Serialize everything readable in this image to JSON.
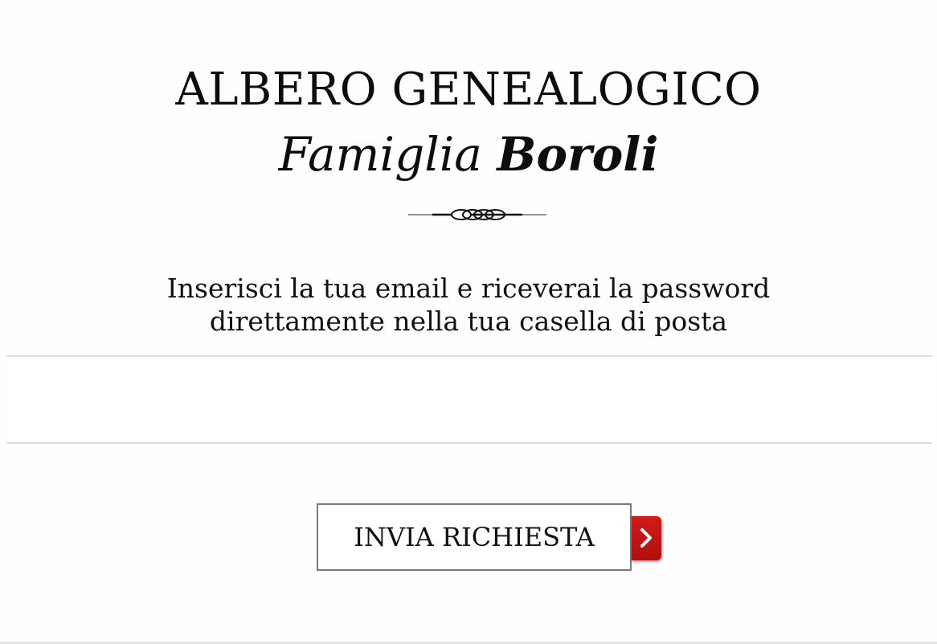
{
  "header": {
    "title": "ALBERO GENEALOGICO",
    "subtitle_prefix": "Famiglia",
    "subtitle_name": "Boroli",
    "ornament_icon": "flourish-divider-icon"
  },
  "instructions": {
    "line1": "Inserisci la tua email e riceverai la password",
    "line2": "direttamente nella tua casella di posta"
  },
  "form": {
    "email_value": "",
    "email_placeholder": ""
  },
  "submit": {
    "label": "INVIA RICHIESTA",
    "icon": "chevron-right-icon",
    "accent_color": "#c8161b"
  }
}
